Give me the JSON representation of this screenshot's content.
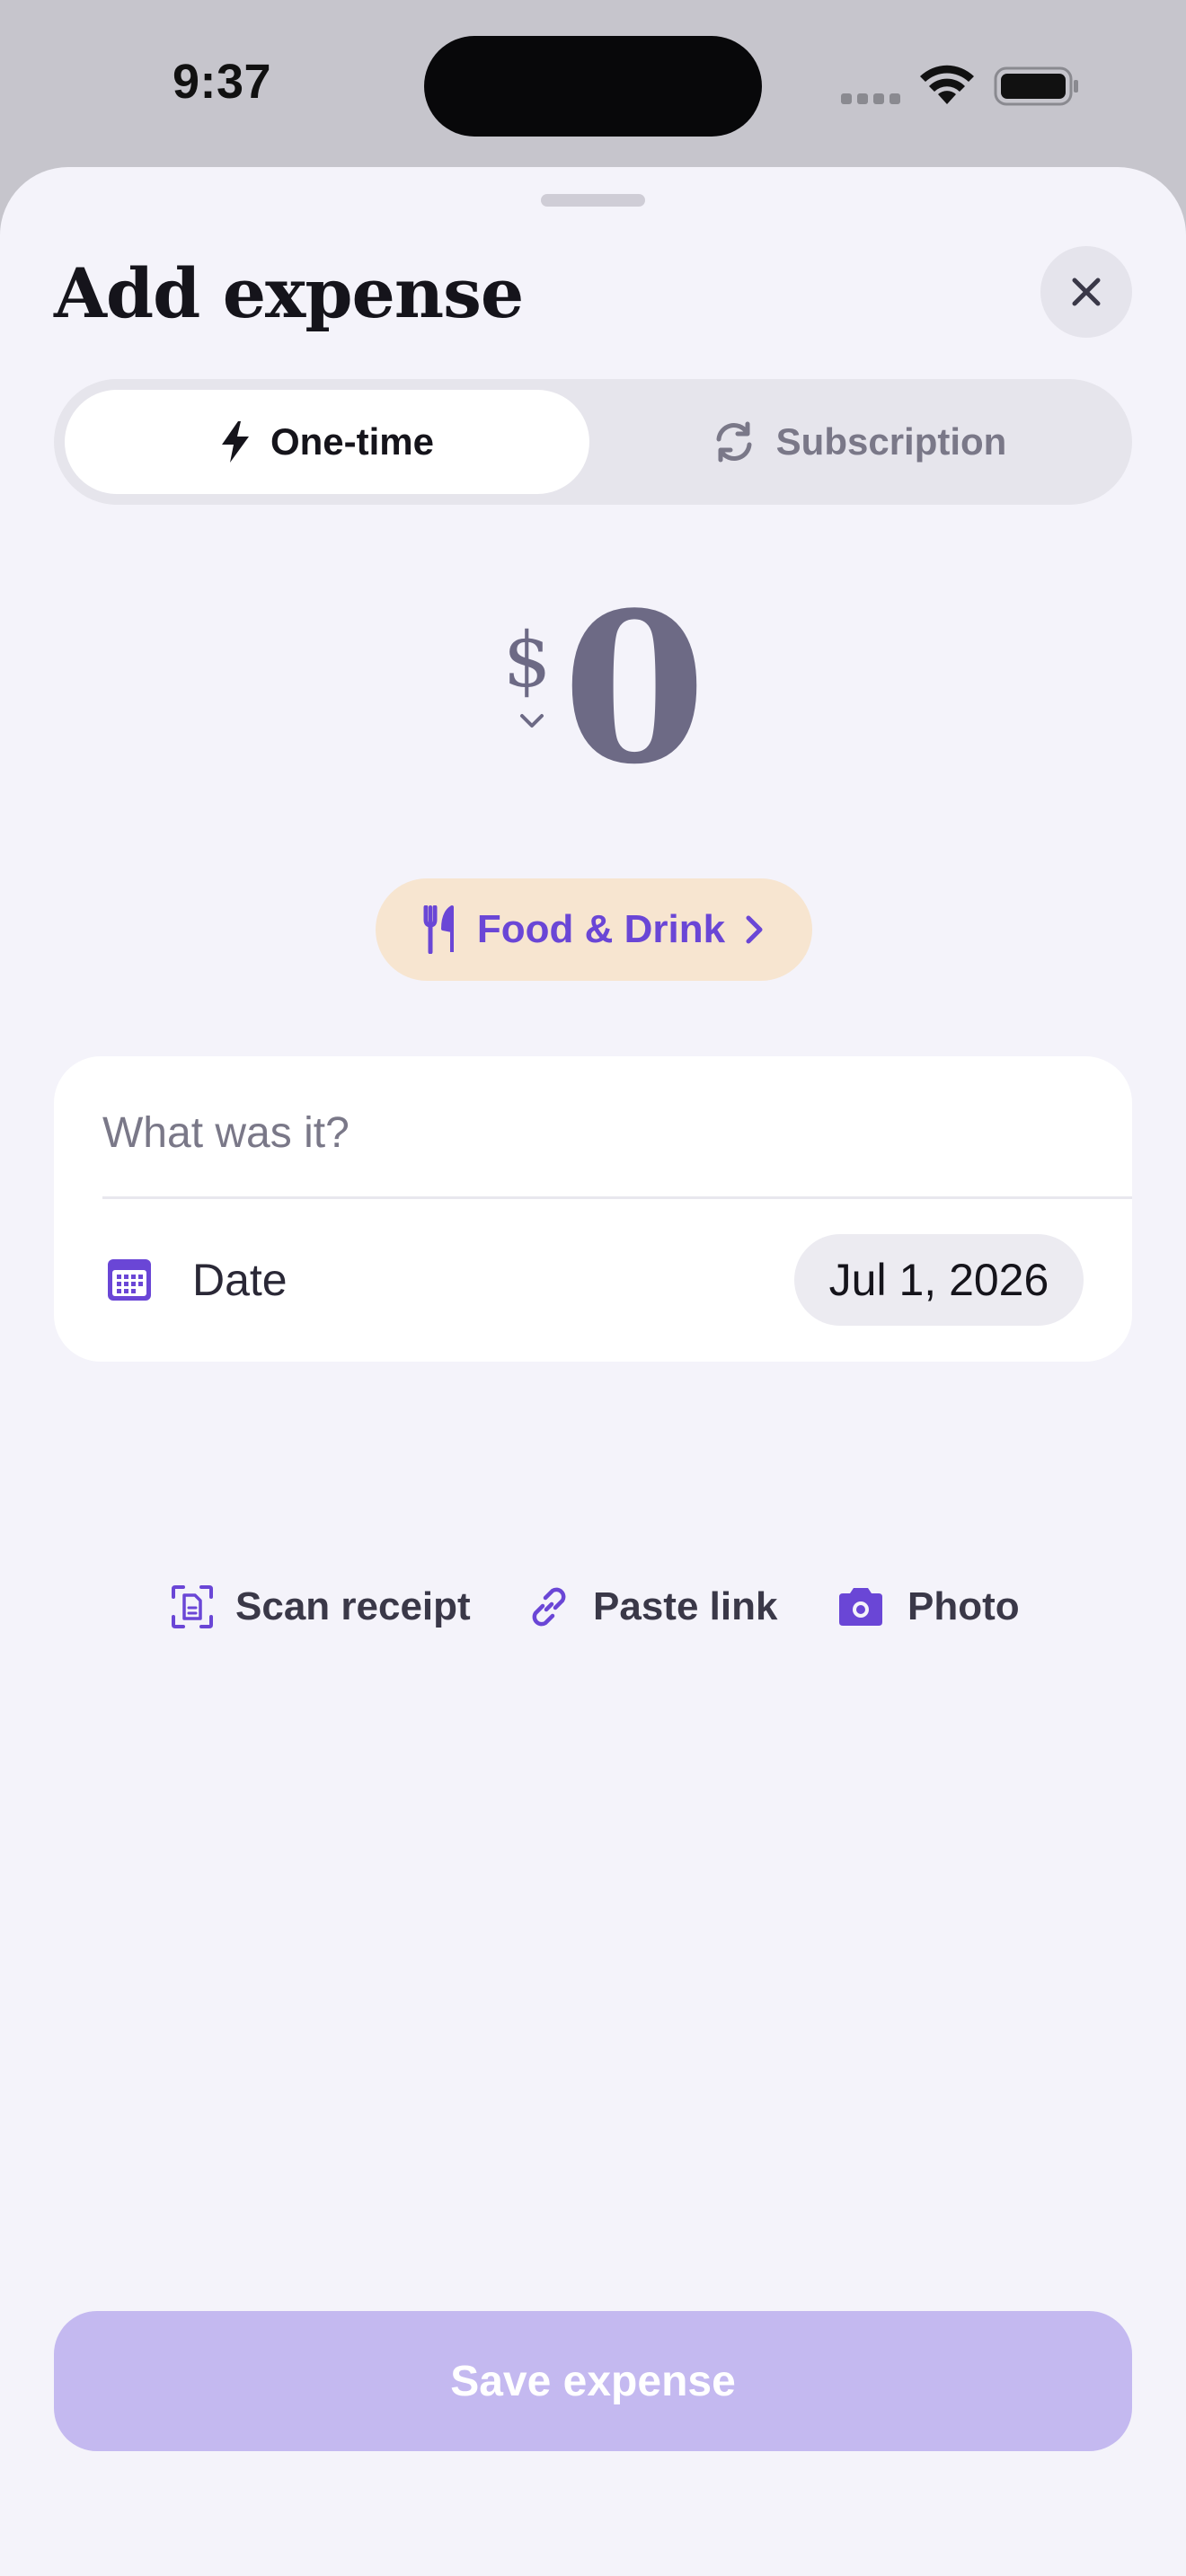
{
  "status_bar": {
    "time": "9:37",
    "icons": [
      "cellular-signal-icon",
      "wifi-icon",
      "battery-icon"
    ]
  },
  "sheet": {
    "title": "Add expense",
    "close_icon": "close-icon"
  },
  "type_toggle": {
    "options": [
      {
        "label": "One-time",
        "icon": "lightning-icon",
        "selected": true
      },
      {
        "label": "Subscription",
        "icon": "refresh-icon",
        "selected": false
      }
    ]
  },
  "amount": {
    "currency_symbol": "$",
    "value": "0",
    "currency_picker_icon": "chevron-down-icon"
  },
  "category": {
    "label": "Food & Drink",
    "icon": "fork-knife-icon",
    "trailing_icon": "chevron-right-icon"
  },
  "form": {
    "description": {
      "value": "",
      "placeholder": "What was it?"
    },
    "date": {
      "label": "Date",
      "value": "Jul 1, 2026",
      "icon": "calendar-icon"
    }
  },
  "attachments": [
    {
      "label": "Scan receipt",
      "icon": "scan-document-icon"
    },
    {
      "label": "Paste link",
      "icon": "link-icon"
    },
    {
      "label": "Photo",
      "icon": "camera-icon"
    }
  ],
  "footer": {
    "save_label": "Save expense",
    "save_enabled": false
  },
  "colors": {
    "accent": "#6a46d6",
    "background": "#f4f3fa",
    "category_chip_bg": "#f7e5d0",
    "save_disabled": "#c4b9f0",
    "amount_text": "#6d6a85"
  }
}
